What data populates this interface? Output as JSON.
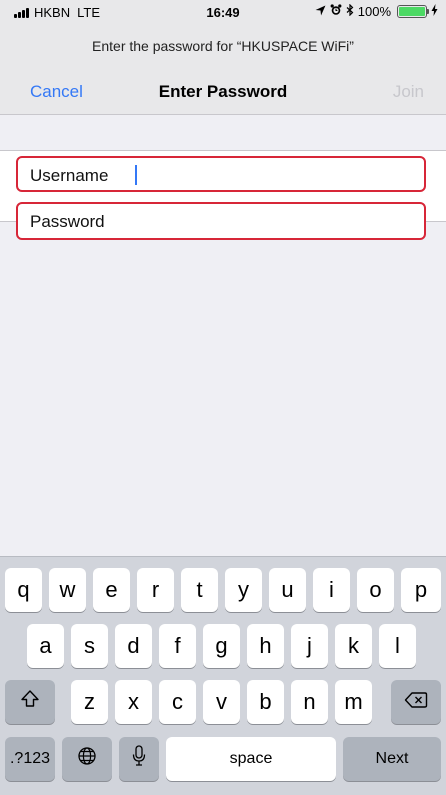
{
  "status_bar": {
    "carrier": "HKBN",
    "network": "LTE",
    "time": "16:49",
    "battery": "100%",
    "battery_level_percent": 100
  },
  "prompt": "Enter the password for “HKUSPACE WiFi”",
  "nav": {
    "cancel_label": "Cancel",
    "title": "Enter Password",
    "join_label": "Join"
  },
  "form": {
    "username_label": "Username",
    "password_label": "Password"
  },
  "keyboard": {
    "row1": [
      "q",
      "w",
      "e",
      "r",
      "t",
      "y",
      "u",
      "i",
      "o",
      "p"
    ],
    "row2": [
      "a",
      "s",
      "d",
      "f",
      "g",
      "h",
      "j",
      "k",
      "l"
    ],
    "row3": [
      "z",
      "x",
      "c",
      "v",
      "b",
      "n",
      "m"
    ],
    "numbers_key": ".?123",
    "space_key": "space",
    "next_key": "Next"
  },
  "colors": {
    "accent": "#3478f6",
    "field_border": "#d72638",
    "battery": "#4cd964"
  }
}
